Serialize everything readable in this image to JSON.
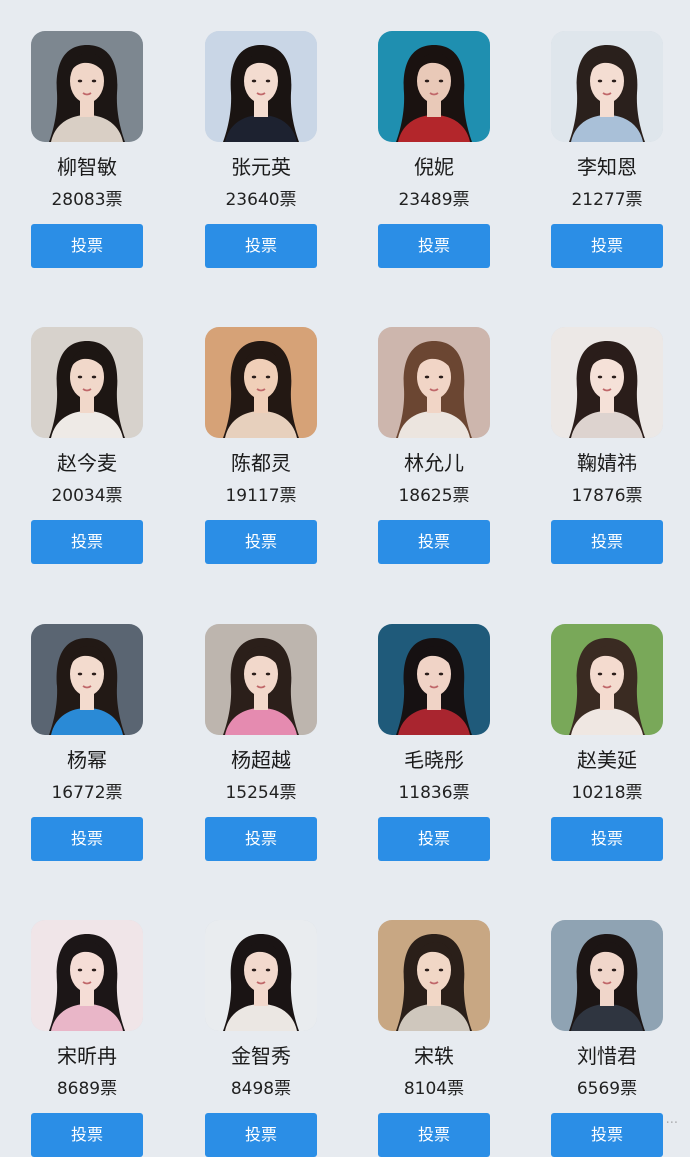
{
  "vote_label": "投票",
  "watermark": "...",
  "candidates": [
    {
      "name": "柳智敏",
      "votes": "28083票",
      "bg": "#7d8790",
      "hair": "#1c1614",
      "skin": "#f0d6c8",
      "cloth": "#d9cfc5",
      "icon": "portrait-icon"
    },
    {
      "name": "张元英",
      "votes": "23640票",
      "bg": "#c9d6e6",
      "hair": "#1a1412",
      "skin": "#f3dcd0",
      "cloth": "#1d2230",
      "icon": "portrait-icon"
    },
    {
      "name": "倪妮",
      "votes": "23489票",
      "bg": "#1f8fb0",
      "hair": "#1a1210",
      "skin": "#e9c9b8",
      "cloth": "#b3262b",
      "icon": "portrait-icon"
    },
    {
      "name": "李知恩",
      "votes": "21277票",
      "bg": "#dfe6ec",
      "hair": "#2a201c",
      "skin": "#f4ddd2",
      "cloth": "#a9c0d8",
      "icon": "portrait-icon"
    },
    {
      "name": "赵今麦",
      "votes": "20034票",
      "bg": "#d7d2cc",
      "hair": "#1d1613",
      "skin": "#f1d8ca",
      "cloth": "#eeeae6",
      "icon": "portrait-icon"
    },
    {
      "name": "陈都灵",
      "votes": "19117票",
      "bg": "#d6a277",
      "hair": "#231813",
      "skin": "#f0cfb8",
      "cloth": "#e7d0bd",
      "icon": "portrait-icon"
    },
    {
      "name": "林允儿",
      "votes": "18625票",
      "bg": "#cdb6ad",
      "hair": "#6b4632",
      "skin": "#f1d5c6",
      "cloth": "#ece5df",
      "icon": "portrait-icon"
    },
    {
      "name": "鞠婧祎",
      "votes": "17876票",
      "bg": "#ece8e6",
      "hair": "#2a1d1a",
      "skin": "#f5e1d8",
      "cloth": "#ddd3cf",
      "icon": "portrait-icon"
    },
    {
      "name": "杨幂",
      "votes": "16772票",
      "bg": "#5a6572",
      "hair": "#221915",
      "skin": "#f3dbce",
      "cloth": "#2a8ad6",
      "icon": "portrait-icon"
    },
    {
      "name": "杨超越",
      "votes": "15254票",
      "bg": "#bdb5ae",
      "hair": "#2b1f1a",
      "skin": "#f2d8cb",
      "cloth": "#e58bb0",
      "icon": "portrait-icon"
    },
    {
      "name": "毛晓彤",
      "votes": "11836票",
      "bg": "#1f5a7a",
      "hair": "#161112",
      "skin": "#f0d3c6",
      "cloth": "#a9252f",
      "icon": "portrait-icon"
    },
    {
      "name": "赵美延",
      "votes": "10218票",
      "bg": "#79a859",
      "hair": "#3a2b22",
      "skin": "#f4dbcf",
      "cloth": "#efe7e2",
      "icon": "portrait-icon"
    },
    {
      "name": "宋昕冉",
      "votes": "8689票",
      "bg": "#f0e5e8",
      "hair": "#1c1617",
      "skin": "#f5ddd6",
      "cloth": "#e9b6c8",
      "icon": "portrait-icon"
    },
    {
      "name": "金智秀",
      "votes": "8498票",
      "bg": "#e9ecef",
      "hair": "#1a1414",
      "skin": "#f2d9cd",
      "cloth": "#ebe7e3",
      "icon": "portrait-icon"
    },
    {
      "name": "宋轶",
      "votes": "8104票",
      "bg": "#c8a783",
      "hair": "#2a1f19",
      "skin": "#f1d7c6",
      "cloth": "#cfc7bd",
      "icon": "portrait-icon"
    },
    {
      "name": "刘惜君",
      "votes": "6569票",
      "bg": "#8fa3b3",
      "hair": "#1c1514",
      "skin": "#f0d6ca",
      "cloth": "#2f3540",
      "icon": "portrait-icon"
    }
  ]
}
